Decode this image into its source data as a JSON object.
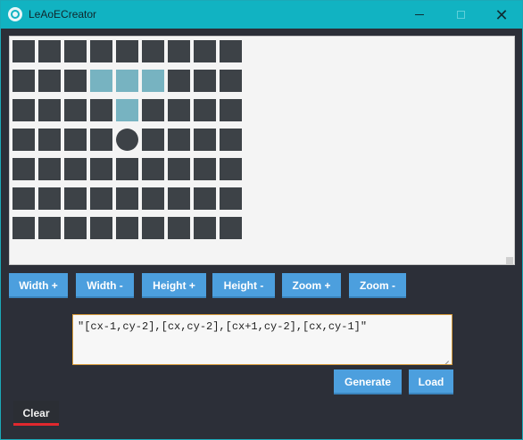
{
  "window": {
    "title": "LeAoECreator",
    "icon": "app-logo-icon",
    "controls": {
      "minimize": "minimize-icon",
      "maximize": "maximize-icon",
      "close_glyph": "✕"
    }
  },
  "grid": {
    "columns": 9,
    "rows": 7,
    "highlighted_cells": [
      [
        3,
        1
      ],
      [
        4,
        1
      ],
      [
        5,
        1
      ],
      [
        4,
        2
      ]
    ],
    "center_cell": [
      4,
      3
    ],
    "cell_color": "#3d4247",
    "highlight_color": "#77b3c1"
  },
  "buttons": {
    "width_plus": "Width +",
    "width_minus": "Width -",
    "height_plus": "Height +",
    "height_minus": "Height -",
    "zoom_plus": "Zoom +",
    "zoom_minus": "Zoom -",
    "generate": "Generate",
    "load": "Load",
    "clear": "Clear"
  },
  "output": {
    "value": "\"[cx-1,cy-2],[cx,cy-2],[cx+1,cy-2],[cx,cy-1]\""
  },
  "colors": {
    "accent": "#11b3c2",
    "button": "#4c9fde",
    "clear_underline": "#e0282e"
  }
}
